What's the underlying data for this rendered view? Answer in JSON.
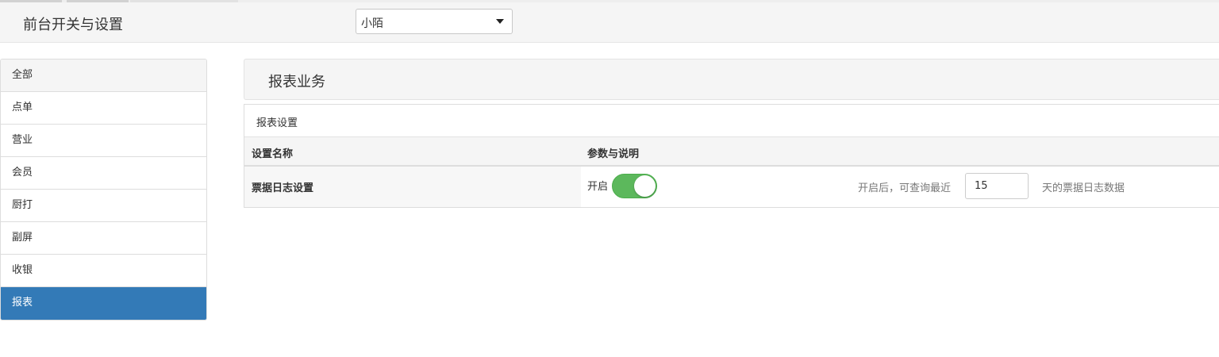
{
  "header": {
    "title": "前台开关与设置",
    "store_select": {
      "value": "小陌"
    }
  },
  "sidebar": {
    "items": [
      {
        "label": "全部"
      },
      {
        "label": "点单"
      },
      {
        "label": "营业"
      },
      {
        "label": "会员"
      },
      {
        "label": "厨打"
      },
      {
        "label": "副屏"
      },
      {
        "label": "收银"
      },
      {
        "label": "报表",
        "active": true
      }
    ]
  },
  "main": {
    "section_title": "报表业务",
    "panel_title": "报表设置",
    "table": {
      "headers": [
        "设置名称",
        "参数与说明"
      ],
      "rows": [
        {
          "name": "票据日志设置",
          "toggle_label": "开启",
          "toggle_on": true,
          "desc_before": "开启后，可查询最近",
          "days_value": "15",
          "desc_after": "天的票据日志数据"
        }
      ]
    }
  },
  "colors": {
    "active_nav": "#337ab7",
    "toggle_on": "#5cb85c",
    "header_bg": "#f5f5f5"
  }
}
